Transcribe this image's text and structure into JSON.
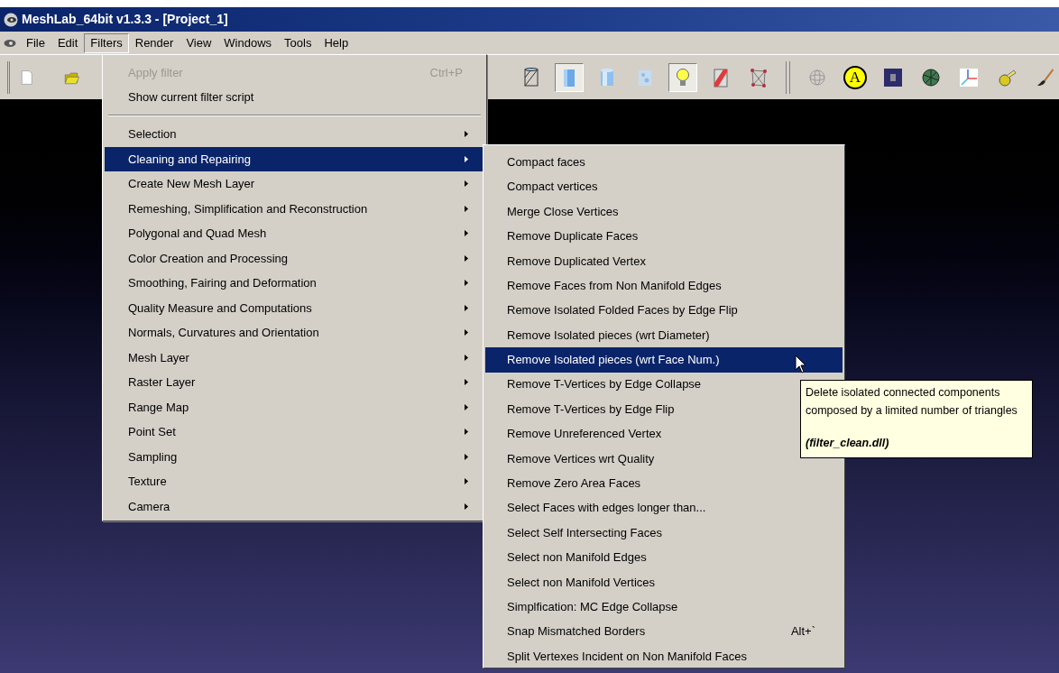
{
  "window": {
    "title": "MeshLab_64bit v1.3.3 - [Project_1]"
  },
  "menu_bar": [
    {
      "label": "File",
      "selected": false
    },
    {
      "label": "Edit",
      "selected": false
    },
    {
      "label": "Filters",
      "selected": true
    },
    {
      "label": "Render",
      "selected": false
    },
    {
      "label": "View",
      "selected": false
    },
    {
      "label": "Windows",
      "selected": false
    },
    {
      "label": "Tools",
      "selected": false
    },
    {
      "label": "Help",
      "selected": false
    }
  ],
  "toolbar": {
    "buttons": [
      {
        "selected": false
      },
      {
        "selected": true
      },
      {
        "selected": false
      },
      {
        "selected": false
      },
      {
        "selected": true
      },
      {
        "selected": false
      },
      {
        "selected": false
      },
      {
        "selected": false
      },
      {
        "selected": false,
        "label": "A"
      },
      {
        "selected": false
      },
      {
        "selected": false
      },
      {
        "selected": false
      },
      {
        "selected": false
      },
      {
        "selected": false
      }
    ]
  },
  "filters_menu": {
    "actions": [
      {
        "label": "Apply filter",
        "shortcut": "Ctrl+P",
        "disabled": true
      },
      {
        "label": "Show current filter script",
        "disabled": false
      }
    ],
    "submenus": [
      {
        "label": "Selection",
        "selected": false
      },
      {
        "label": "Cleaning and Repairing",
        "selected": true
      },
      {
        "label": "Create New Mesh Layer",
        "selected": false
      },
      {
        "label": "Remeshing, Simplification and Reconstruction",
        "selected": false
      },
      {
        "label": "Polygonal and Quad Mesh",
        "selected": false
      },
      {
        "label": "Color Creation and Processing",
        "selected": false
      },
      {
        "label": "Smoothing, Fairing and Deformation",
        "selected": false
      },
      {
        "label": "Quality Measure and Computations",
        "selected": false
      },
      {
        "label": "Normals, Curvatures and Orientation",
        "selected": false
      },
      {
        "label": "Mesh Layer",
        "selected": false
      },
      {
        "label": "Raster Layer",
        "selected": false
      },
      {
        "label": "Range Map",
        "selected": false
      },
      {
        "label": "Point Set",
        "selected": false
      },
      {
        "label": "Sampling",
        "selected": false
      },
      {
        "label": "Texture",
        "selected": false
      },
      {
        "label": "Camera",
        "selected": false
      }
    ]
  },
  "cleaning_submenu": [
    {
      "label": "Compact faces",
      "selected": false
    },
    {
      "label": "Compact vertices",
      "selected": false
    },
    {
      "label": "Merge Close Vertices",
      "selected": false
    },
    {
      "label": "Remove Duplicate Faces",
      "selected": false
    },
    {
      "label": "Remove Duplicated Vertex",
      "selected": false
    },
    {
      "label": "Remove Faces from Non Manifold Edges",
      "selected": false
    },
    {
      "label": "Remove Isolated Folded Faces by Edge Flip",
      "selected": false
    },
    {
      "label": "Remove Isolated pieces (wrt Diameter)",
      "selected": false
    },
    {
      "label": "Remove Isolated pieces (wrt Face Num.)",
      "selected": true
    },
    {
      "label": "Remove T-Vertices by Edge Collapse",
      "selected": false
    },
    {
      "label": "Remove T-Vertices by Edge Flip",
      "selected": false
    },
    {
      "label": "Remove Unreferenced Vertex",
      "selected": false
    },
    {
      "label": "Remove Vertices wrt Quality",
      "selected": false
    },
    {
      "label": "Remove Zero Area Faces",
      "selected": false
    },
    {
      "label": "Select Faces with edges longer than...",
      "selected": false
    },
    {
      "label": "Select Self Intersecting Faces",
      "selected": false
    },
    {
      "label": "Select non Manifold Edges",
      "selected": false
    },
    {
      "label": "Select non Manifold Vertices",
      "selected": false
    },
    {
      "label": "Simplfication: MC Edge Collapse",
      "selected": false
    },
    {
      "label": "Snap Mismatched Borders",
      "shortcut": "Alt+`",
      "selected": false
    },
    {
      "label": "Split Vertexes Incident on Non Manifold Faces",
      "selected": false
    }
  ],
  "tooltip": {
    "description": "Delete isolated connected components composed by a limited number of triangles",
    "plugin": "(filter_clean.dll)"
  }
}
